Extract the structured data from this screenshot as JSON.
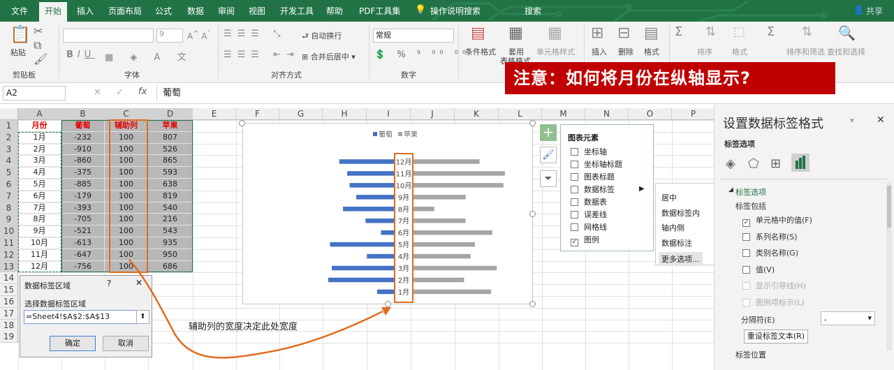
{
  "tabs": [
    "文件",
    "开始",
    "插入",
    "页面布局",
    "公式",
    "数据",
    "审阅",
    "视图",
    "开发工具",
    "帮助",
    "PDF工具集",
    "操作说明搜索",
    "搜索",
    "共享"
  ],
  "ribbon": {
    "clipboard": {
      "paste": "粘贴",
      "label": "剪贴板"
    },
    "font": {
      "size": "9",
      "label": "字体"
    },
    "align": {
      "wrap": "自动换行",
      "merge": "合并后居中",
      "label": "对齐方式"
    },
    "number": {
      "format": "常规",
      "label": "数字"
    },
    "styles": {
      "cond": "条件格式",
      "table": "套用",
      "table2": "表格格式",
      "cellstyle": "单元格样式"
    },
    "cells": {
      "insert": "插入",
      "delete": "删除",
      "format": "格式"
    },
    "editing": {
      "clear": "排序",
      "clear2": "格式",
      "sort": "排序和筛选",
      "find": "查找和选择"
    }
  },
  "notice": "注意：如何将月份在纵轴显示?",
  "formula": {
    "namebox": "A2",
    "fx": "fx",
    "value": "葡萄",
    "cancel": "✕",
    "enter": "✓"
  },
  "columns": [
    "A",
    "B",
    "C",
    "D",
    "E",
    "F",
    "G",
    "H",
    "I",
    "J",
    "K",
    "L",
    "M",
    "N",
    "O",
    "P"
  ],
  "rows": [
    "1",
    "2",
    "3",
    "4",
    "5",
    "6",
    "7",
    "8",
    "9",
    "10",
    "11",
    "12",
    "13",
    "14",
    "15",
    "16",
    "17",
    "18",
    "19"
  ],
  "table": {
    "headers": [
      "月份",
      "葡萄",
      "辅助列",
      "苹果"
    ],
    "data": [
      [
        "1月",
        "-232",
        "100",
        "807"
      ],
      [
        "2月",
        "-910",
        "100",
        "526"
      ],
      [
        "3月",
        "-860",
        "100",
        "865"
      ],
      [
        "4月",
        "-375",
        "100",
        "593"
      ],
      [
        "5月",
        "-885",
        "100",
        "638"
      ],
      [
        "6月",
        "-179",
        "100",
        "819"
      ],
      [
        "7月",
        "-393",
        "100",
        "540"
      ],
      [
        "8月",
        "-705",
        "100",
        "216"
      ],
      [
        "9月",
        "-521",
        "100",
        "543"
      ],
      [
        "10月",
        "-613",
        "100",
        "935"
      ],
      [
        "11月",
        "-647",
        "100",
        "950"
      ],
      [
        "12月",
        "-756",
        "100",
        "686"
      ]
    ]
  },
  "chart_data": {
    "type": "bar",
    "categories": [
      "1月",
      "2月",
      "3月",
      "4月",
      "5月",
      "6月",
      "7月",
      "8月",
      "9月",
      "10月",
      "11月",
      "12月"
    ],
    "series": [
      {
        "name": "葡萄",
        "values": [
          -232,
          -910,
          -860,
          -375,
          -885,
          -179,
          -393,
          -705,
          -521,
          -613,
          -647,
          -756
        ],
        "color": "#4472c4"
      },
      {
        "name": "苹果",
        "values": [
          807,
          526,
          865,
          593,
          638,
          819,
          540,
          216,
          543,
          935,
          950,
          686
        ],
        "color": "#a5a5a5"
      }
    ],
    "xlim": [
      -1000,
      1000
    ],
    "legend": "top",
    "grid": false,
    "category_order": "bottom-to-top"
  },
  "chart_elements": {
    "title": "图表元素",
    "items": [
      {
        "label": "坐标轴",
        "checked": false
      },
      {
        "label": "坐标轴标题",
        "checked": false
      },
      {
        "label": "图表标题",
        "checked": false
      },
      {
        "label": "数据标签",
        "checked": false
      },
      {
        "label": "数据表",
        "checked": false
      },
      {
        "label": "误差线",
        "checked": false
      },
      {
        "label": "网格线",
        "checked": false
      },
      {
        "label": "图例",
        "checked": true
      }
    ],
    "submenu": [
      "居中",
      "数据标签内",
      "轴内侧",
      "数据标注",
      "更多选项..."
    ]
  },
  "dialog": {
    "title": "数据标签区域",
    "help": "?",
    "close": "✕",
    "prompt": "选择数据标签区域",
    "value": "=Sheet4!$A$2:$A$13",
    "ok": "确定",
    "cancel": "取消"
  },
  "annotation": "辅助列的宽度决定此处宽度",
  "pane": {
    "title": "设置数据标签格式",
    "subtitle": "标签选项",
    "section": "标签选项",
    "includes": "标签包括",
    "options": [
      {
        "label": "单元格中的值(F)",
        "checked": true,
        "enabled": true
      },
      {
        "label": "系列名称(S)",
        "checked": false,
        "enabled": true
      },
      {
        "label": "类别名称(G)",
        "checked": false,
        "enabled": true
      },
      {
        "label": "值(V)",
        "checked": false,
        "enabled": true
      },
      {
        "label": "显示引导线(H)",
        "checked": false,
        "enabled": false
      },
      {
        "label": "图例项标示(L)",
        "checked": false,
        "enabled": false
      }
    ],
    "separator_label": "分隔符(E)",
    "separator_value": ",",
    "reset": "重设标签文本(R)",
    "position": "标签位置"
  },
  "colors": {
    "excel_green": "#217346",
    "notice_red": "#c00000",
    "highlight_orange": "#e06c1f",
    "header_red": "#e00000"
  }
}
